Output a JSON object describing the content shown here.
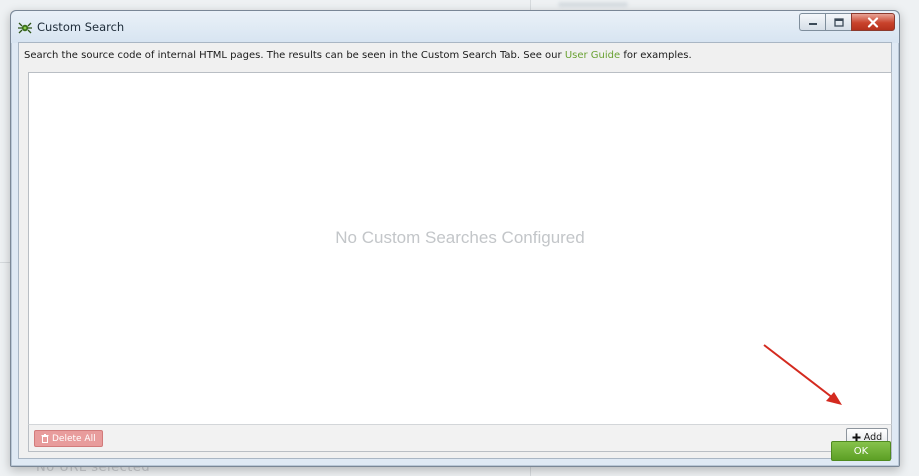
{
  "background": {
    "bottom_text": "No URL selected"
  },
  "dialog": {
    "title": "Custom Search",
    "app_icon": "spider-icon",
    "window_controls": {
      "minimize": "minimize-icon",
      "maximize": "maximize-icon",
      "close": "close-icon"
    },
    "description_prefix": "Search the source code of internal HTML pages. The results can be seen in the Custom Search Tab. See our ",
    "description_link": "User Guide",
    "description_suffix": " for examples.",
    "empty_message": "No Custom Searches Configured",
    "delete_all_label": "Delete All",
    "add_label": "Add",
    "ok_label": "OK"
  },
  "colors": {
    "link": "#6aa233",
    "ok_button": "#6aab2e",
    "delete_button": "#e89c9c",
    "annotation_arrow": "#d42a1f"
  }
}
